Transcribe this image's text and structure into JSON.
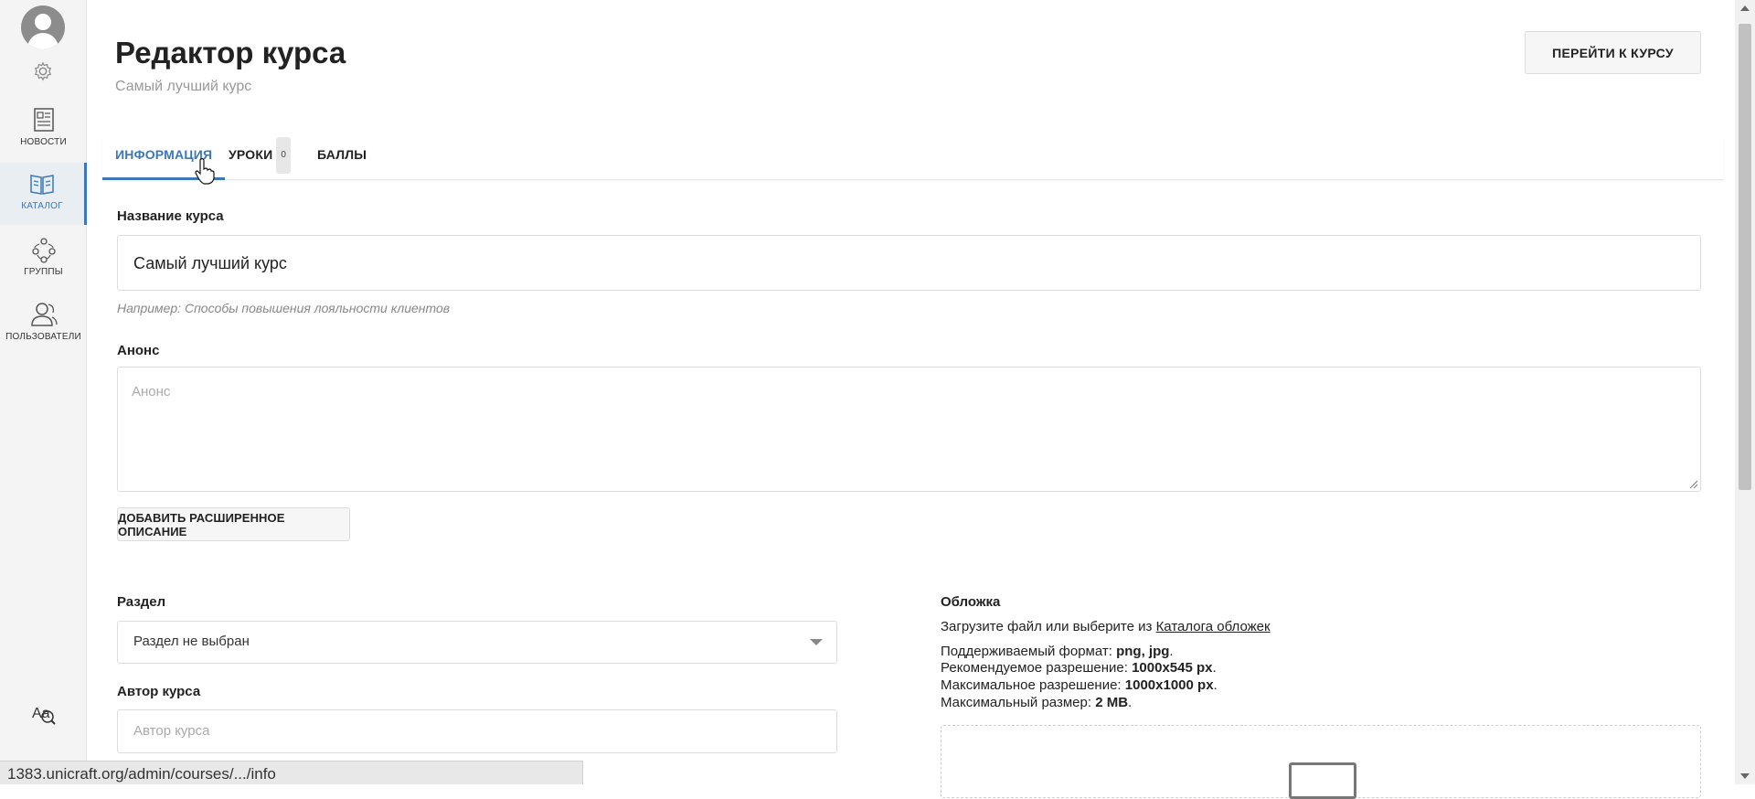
{
  "sidebar": {
    "items": [
      {
        "label": "Новости",
        "icon": "newspaper-icon"
      },
      {
        "label": "Каталог",
        "icon": "book-icon",
        "active": true
      },
      {
        "label": "Группы",
        "icon": "groups-icon"
      },
      {
        "label": "Пользователи",
        "icon": "users-icon"
      }
    ]
  },
  "header": {
    "title": "Редактор курса",
    "subtitle": "Самый лучший курс",
    "goto_button": "ПЕРЕЙТИ К КУРСУ"
  },
  "tabs": {
    "info": "ИНФОРМАЦИЯ",
    "lessons": "УРОКИ",
    "lessons_count": "0",
    "points": "БАЛЛЫ"
  },
  "form": {
    "course_name_label": "Название курса",
    "course_name_value": "Самый лучший курс",
    "course_name_hint": "Например: Способы повышения лояльности клиентов",
    "announce_label": "Анонс",
    "announce_placeholder": "Анонс",
    "add_description_button": "ДОБАВИТЬ РАСШИРЕННОЕ ОПИСАНИЕ",
    "section_label": "Раздел",
    "section_value": "Раздел не выбран",
    "author_label": "Автор курса",
    "author_placeholder": "Автор курса"
  },
  "cover": {
    "title": "Обложка",
    "upload_text": "Загрузите файл или выберите из",
    "catalog_link": "Каталога обложек",
    "format_label": "Поддерживаемый формат:",
    "format_value": "png, jpg",
    "rec_label": "Рекомендуемое разрешение:",
    "rec_value": "1000x545 px",
    "max_res_label": "Максимальное разрешение:",
    "max_res_value": "1000x1000 px",
    "max_size_label": "Максимальный размер:",
    "max_size_value": "2 MB"
  },
  "status_bar": {
    "url": "1383.unicraft.org/admin/courses/.../info"
  },
  "colors": {
    "accent": "#3b78b4",
    "sidebar_bg": "#f4f4f4"
  }
}
